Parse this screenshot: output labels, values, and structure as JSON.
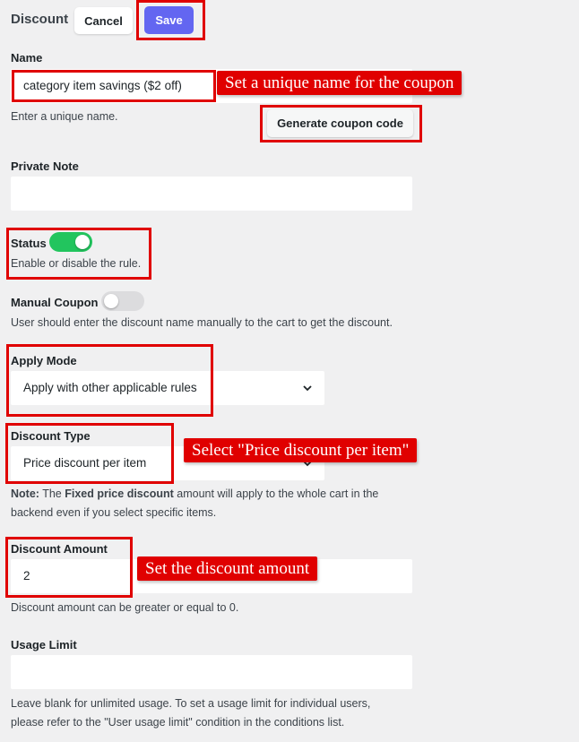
{
  "header": {
    "title": "Discount",
    "cancel_label": "Cancel",
    "save_label": "Save"
  },
  "name_field": {
    "label": "Name",
    "value": "category item savings ($2 off)",
    "help": "Enter a unique name.",
    "generate_label": "Generate coupon code"
  },
  "private_note": {
    "label": "Private Note",
    "value": ""
  },
  "status": {
    "label": "Status",
    "enabled": true,
    "help": "Enable or disable the rule."
  },
  "manual_coupon": {
    "label": "Manual Coupon",
    "enabled": false,
    "help": "User should enter the discount name manually to the cart to get the discount."
  },
  "apply_mode": {
    "label": "Apply Mode",
    "selected": "Apply with other applicable rules"
  },
  "discount_type": {
    "label": "Discount Type",
    "selected": "Price discount per item",
    "note_prefix": "Note:",
    "note_text1": " The ",
    "note_bold": "Fixed price discount",
    "note_text2": " amount will apply to the whole cart in the",
    "note_line2": "backend even if you select specific items."
  },
  "discount_amount": {
    "label": "Discount Amount",
    "value": "2",
    "help": "Discount amount can be greater or equal to 0."
  },
  "usage_limit": {
    "label": "Usage Limit",
    "value": "",
    "help_line1": "Leave blank for unlimited usage. To set a usage limit for individual users,",
    "help_line2": "please refer to the \"User usage limit\" condition in the conditions list."
  },
  "callouts": {
    "name": "Set a unique name for the coupon",
    "discount_type": "Select \"Price discount per item\"",
    "discount_amount": "Set the discount amount"
  },
  "colors": {
    "accent": "#6366f1",
    "toggle_on": "#22c55e",
    "toggle_off": "#dcdcde",
    "annotation_red": "#e00000"
  }
}
